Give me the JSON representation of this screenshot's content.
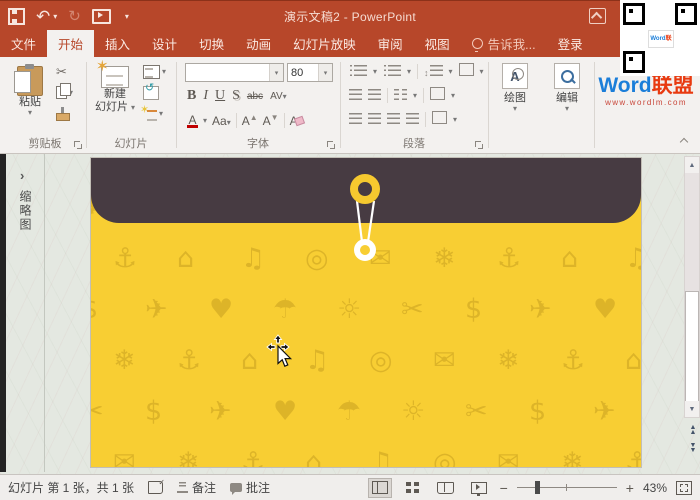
{
  "titlebar": {
    "title": "演示文稿2 - PowerPoint"
  },
  "tabs": {
    "file": "文件",
    "home": "开始",
    "insert": "插入",
    "design": "设计",
    "transitions": "切换",
    "animations": "动画",
    "slideshow": "幻灯片放映",
    "review": "审阅",
    "view": "视图",
    "tellme": "告诉我...",
    "signin": "登录"
  },
  "ribbon": {
    "groups": {
      "clipboard": "剪贴板",
      "slides": "幻灯片",
      "font": "字体",
      "paragraph": "段落"
    },
    "paste": "粘贴",
    "new_slide_l1": "新建",
    "new_slide_l2": "幻灯片",
    "font_name": "",
    "font_size": "80",
    "mini": {
      "bold": "B",
      "italic": "I",
      "underline": "U",
      "shadow": "S",
      "strike": "abc",
      "spacing": "AV",
      "font_color": "A",
      "case": "Aa",
      "grow": "A",
      "shrink": "A"
    },
    "draw": "绘图",
    "edit": "编辑"
  },
  "brand": {
    "name_en": "Word",
    "name_cn": "联盟",
    "url": "www.wordlm.com"
  },
  "panel": {
    "thumbnails": "缩略图"
  },
  "statusbar": {
    "slide_info": "幻灯片 第 1 张，共 1 张",
    "notes": "备注",
    "comments": "批注",
    "zoom": "43%"
  },
  "slide": {
    "pattern_icons": [
      "✈",
      "✉",
      "♥",
      "❄",
      "☂",
      "⚓",
      "☼",
      "⌂",
      "✂",
      "♫",
      "$",
      "◎"
    ]
  },
  "colors": {
    "titlebar": "#B7472A",
    "ribbon_bg": "#F3F1EF",
    "workspace": "#E4E8E1",
    "envelope_yellow": "#F8CE33",
    "envelope_flap": "#473B42",
    "pattern": "#C49C1E",
    "brand_blue": "#1B7ED9",
    "brand_red": "#E83A10"
  }
}
